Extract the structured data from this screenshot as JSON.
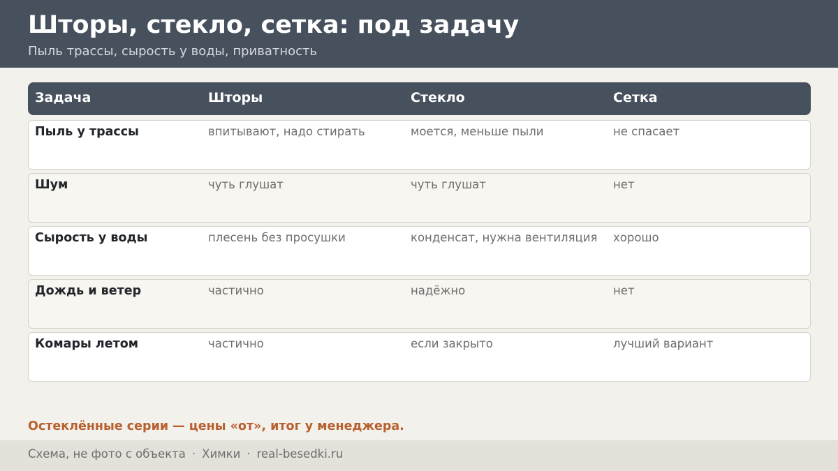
{
  "header": {
    "title": "Шторы, стекло, сетка: под задачу",
    "subtitle": "Пыль трассы, сырость у воды, приватность"
  },
  "table": {
    "columns": [
      "Задача",
      "Шторы",
      "Стекло",
      "Сетка"
    ],
    "rows": [
      {
        "task": "Пыль у трассы",
        "curtains": "впитывают, надо стирать",
        "glass": "моется, меньше пыли",
        "mesh": "не спасает"
      },
      {
        "task": "Шум",
        "curtains": "чуть глушат",
        "glass": "чуть глушат",
        "mesh": "нет"
      },
      {
        "task": "Сырость у воды",
        "curtains": "плесень без просушки",
        "glass": "конденсат, нужна вентиляция",
        "mesh": "хорошо"
      },
      {
        "task": "Дождь и ветер",
        "curtains": "частично",
        "glass": "надёжно",
        "mesh": "нет"
      },
      {
        "task": "Комары летом",
        "curtains": "частично",
        "glass": "если закрыто",
        "mesh": "лучший вариант"
      }
    ]
  },
  "note": "Остеклённые серии — цены «от», итог у менеджера.",
  "footer": {
    "items": [
      "Схема, не фото с объекта",
      "Химки",
      "real-besedki.ru"
    ],
    "separator": "·"
  },
  "colors": {
    "header_bg": "#47505d",
    "accent": "#b8602f",
    "page_bg": "#f3f1ec"
  }
}
